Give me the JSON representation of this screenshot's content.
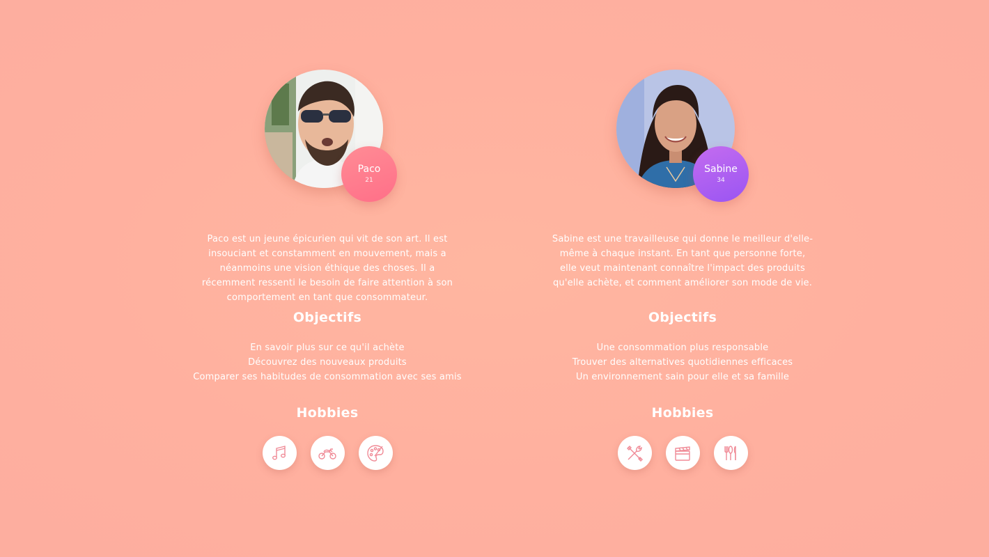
{
  "colors": {
    "background": "#ffb3a0",
    "paco_badge": "#ff7a8c",
    "sabine_badge": "#a95cf2",
    "icon_stroke": "#f08a96"
  },
  "personas": [
    {
      "name": "Paco",
      "age": "21",
      "bio": "Paco est un jeune épicurien qui vit de son art. Il est insouciant et constamment en mouvement, mais a néanmoins une vision éthique des choses. Il a récemment ressenti le besoin de faire attention à son comportement en tant que consommateur.",
      "objectives_title": "Objectifs",
      "objectives": [
        "En savoir plus sur ce qu'il achète",
        "Découvrez des nouveaux produits",
        "Comparer ses habitudes de consommation avec ses amis"
      ],
      "hobbies_title": "Hobbies",
      "hobbies": [
        "music-note-icon",
        "motorcycle-icon",
        "paint-palette-icon"
      ]
    },
    {
      "name": "Sabine",
      "age": "34",
      "bio": "Sabine est une travailleuse qui donne le meilleur d'elle-même à chaque instant. En tant que personne forte, elle veut maintenant connaître l'impact des produits qu'elle achète, et comment améliorer son mode de vie.",
      "objectives_title": "Objectifs",
      "objectives": [
        "Une consommation plus responsable",
        "Trouver des alternatives quotidiennes efficaces",
        "Un environnement sain pour elle et sa famille"
      ],
      "hobbies_title": "Hobbies",
      "hobbies": [
        "tools-icon",
        "clapperboard-icon",
        "cutlery-icon"
      ]
    }
  ]
}
